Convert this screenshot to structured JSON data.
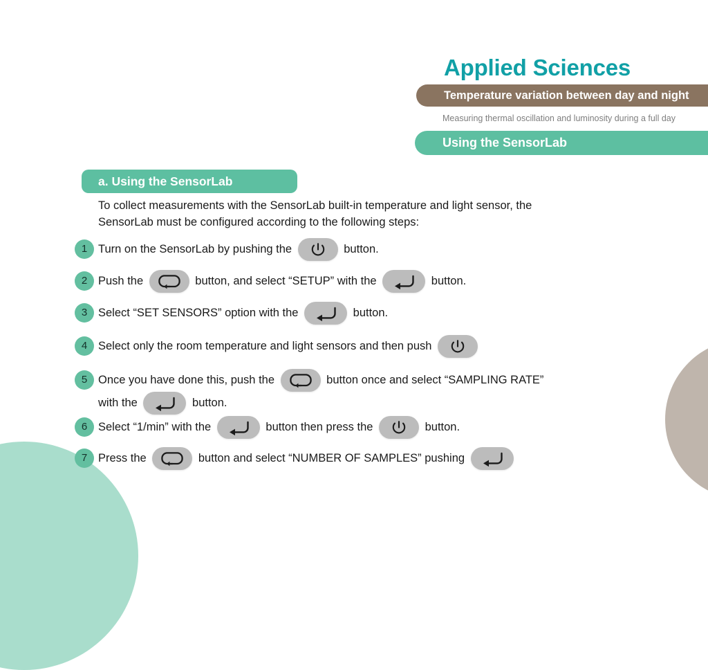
{
  "page": {
    "background": "#ffffff",
    "accent_green": "#5dbfa1",
    "accent_teal": "#11a0a6",
    "accent_brown": "#8a7460",
    "deco_mint": "#a9ddcc",
    "deco_taupe": "#bfb5ac",
    "button_gray": "#bcbcbc"
  },
  "header": {
    "brand": "Applied Sciences",
    "topic": "Temperature variation between day and night",
    "subtitle": "Measuring thermal oscillation and luminosity during a full day",
    "section": "Using the SensorLab"
  },
  "main": {
    "section_title": "a. Using the SensorLab",
    "intro": "To collect measurements with the SensorLab built-in temperature and light sensor, the SensorLab must be configured according to the following steps:"
  },
  "icons": {
    "power": "power-button-icon",
    "enter": "enter-arrow-button-icon",
    "loop": "loop-arrow-button-icon"
  },
  "steps": [
    {
      "number": "1",
      "parts": [
        {
          "type": "text",
          "value": "Turn on the SensorLab by pushing the "
        },
        {
          "type": "icon",
          "value": "power"
        },
        {
          "type": "text",
          "value": " button."
        }
      ]
    },
    {
      "number": "2",
      "parts": [
        {
          "type": "text",
          "value": "Push the "
        },
        {
          "type": "icon",
          "value": "loop"
        },
        {
          "type": "text",
          "value": " button, and select “SETUP” with the "
        },
        {
          "type": "icon",
          "value": "enter"
        },
        {
          "type": "text",
          "value": " button."
        }
      ]
    },
    {
      "number": "3",
      "parts": [
        {
          "type": "text",
          "value": "Select “SET SENSORS” option with the "
        },
        {
          "type": "icon",
          "value": "enter"
        },
        {
          "type": "text",
          "value": " button."
        }
      ]
    },
    {
      "number": "4",
      "parts": [
        {
          "type": "text",
          "value": "Select only the room temperature and light sensors and then push "
        },
        {
          "type": "icon",
          "value": "power"
        }
      ]
    },
    {
      "number": "5",
      "parts": [
        {
          "type": "text",
          "value": "Once you have done this, push the "
        },
        {
          "type": "icon",
          "value": "loop"
        },
        {
          "type": "text",
          "value": " button once and select “SAMPLING RATE”"
        },
        {
          "type": "break",
          "value": ""
        },
        {
          "type": "text",
          "value": "with the "
        },
        {
          "type": "icon",
          "value": "enter"
        },
        {
          "type": "text",
          "value": " button."
        }
      ]
    },
    {
      "number": "6",
      "parts": [
        {
          "type": "text",
          "value": "Select “1/min” with the "
        },
        {
          "type": "icon",
          "value": "enter"
        },
        {
          "type": "text",
          "value": " button then press the "
        },
        {
          "type": "icon",
          "value": "power"
        },
        {
          "type": "text",
          "value": " button."
        }
      ]
    },
    {
      "number": "7",
      "parts": [
        {
          "type": "text",
          "value": "Press the "
        },
        {
          "type": "icon",
          "value": "loop"
        },
        {
          "type": "text",
          "value": " button and select “NUMBER OF SAMPLES” pushing "
        },
        {
          "type": "icon",
          "value": "enter"
        }
      ]
    }
  ]
}
